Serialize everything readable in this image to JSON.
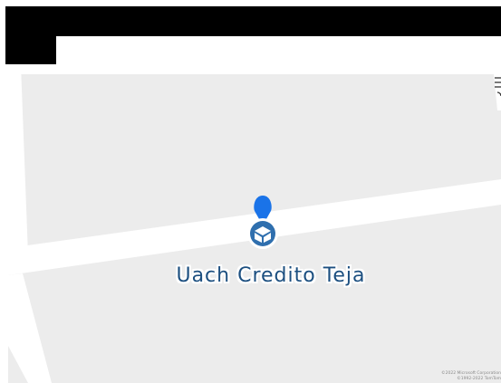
{
  "place": {
    "name": "Uach Credito Teja",
    "pin_color": "#1a73e8",
    "marker_icon": "package-box-icon",
    "label_color": "#1c4f80"
  },
  "map": {
    "background_color": "#ececec",
    "road_color": "#ffffff",
    "attribution": [
      "©2022 Microsoft Corporation",
      "©1992-2022 TomTom"
    ]
  }
}
